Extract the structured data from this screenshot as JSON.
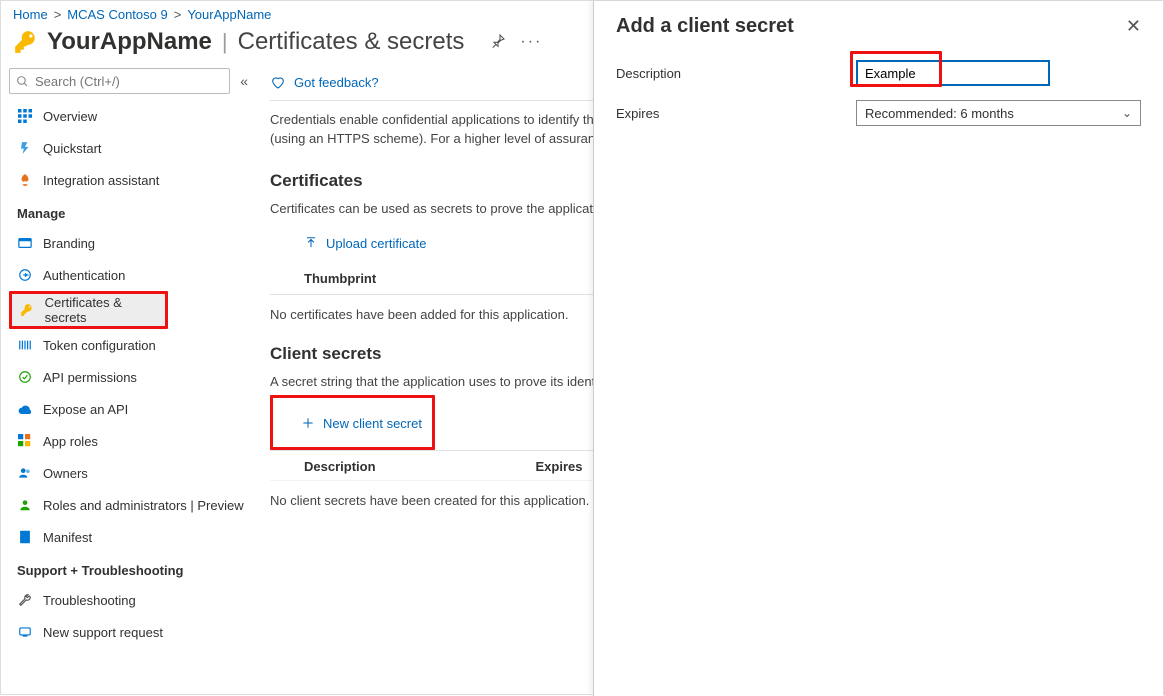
{
  "breadcrumb": [
    {
      "label": "Home"
    },
    {
      "label": "MCAS Contoso 9"
    },
    {
      "label": "YourAppName"
    }
  ],
  "header": {
    "app_name": "YourAppName",
    "subtitle": "Certificates & secrets"
  },
  "search": {
    "placeholder": "Search (Ctrl+/)"
  },
  "nav": {
    "top": [
      {
        "label": "Overview"
      },
      {
        "label": "Quickstart"
      },
      {
        "label": "Integration assistant"
      }
    ],
    "manage_header": "Manage",
    "manage": [
      {
        "label": "Branding"
      },
      {
        "label": "Authentication"
      },
      {
        "label": "Certificates & secrets",
        "active": true
      },
      {
        "label": "Token configuration"
      },
      {
        "label": "API permissions"
      },
      {
        "label": "Expose an API"
      },
      {
        "label": "App roles"
      },
      {
        "label": "Owners"
      },
      {
        "label": "Roles and administrators | Preview"
      },
      {
        "label": "Manifest"
      }
    ],
    "support_header": "Support + Troubleshooting",
    "support": [
      {
        "label": "Troubleshooting"
      },
      {
        "label": "New support request"
      }
    ]
  },
  "main": {
    "feedback": "Got feedback?",
    "intro": "Credentials enable confidential applications to identify themselves to the authentication service when receiving tokens at a web addressable location (using an HTTPS scheme). For a higher level of assurance, we recommend using a certificate (instead of a client secret) as a credential.",
    "cert_title": "Certificates",
    "cert_sub": "Certificates can be used as secrets to prove the application's identity when requesting a token. Also can be referred to as public keys.",
    "upload_label": "Upload certificate",
    "thumb_header": "Thumbprint",
    "cert_none": "No certificates have been added for this application.",
    "secrets_title": "Client secrets",
    "secrets_sub": "A secret string that the application uses to prove its identity when requesting a token. Also can be referred to as application password.",
    "new_secret_label": "New client secret",
    "col_desc": "Description",
    "col_expires": "Expires",
    "secrets_none": "No client secrets have been created for this application."
  },
  "panel": {
    "title": "Add a client secret",
    "desc_label": "Description",
    "desc_value": "Example",
    "expires_label": "Expires",
    "expires_value": "Recommended: 6 months"
  }
}
